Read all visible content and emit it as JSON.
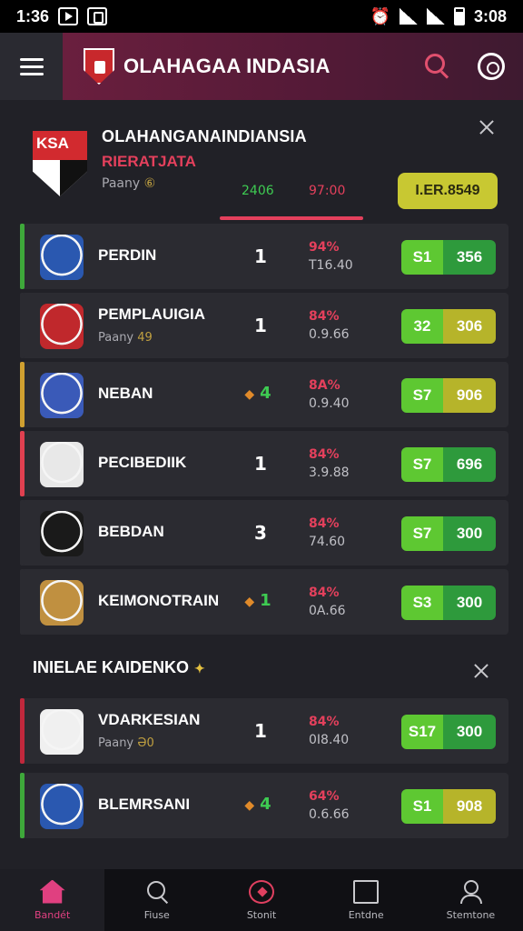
{
  "status_bar": {
    "time": "1:36",
    "clock_right": "3:08"
  },
  "app_bar": {
    "title": "OLAHAGAA INDASIA"
  },
  "league": {
    "logo_text": "KSA",
    "title": "OLAHANGANAINDIANSIA",
    "subtitle": "RIERATJATA",
    "meta_label": "Paany",
    "meta_value": "⑥",
    "score_a": "2406",
    "score_b": "97:00",
    "odds": "I.ER.8549"
  },
  "matches": [
    {
      "name": "PERDIN",
      "meta_label": "",
      "meta_value": "",
      "score": "1",
      "pct": "94%",
      "line": "T16.40",
      "odd_a": "S1",
      "odd_b": "356",
      "accent": "#3ea83a",
      "crest": "#2a58b0",
      "pill": "green"
    },
    {
      "name": "PEMPLAUIGIA",
      "meta_label": "Paany",
      "meta_value": "49",
      "score": "1",
      "pct": "84%",
      "line": "0.9.66",
      "odd_a": "32",
      "odd_b": "306",
      "accent": "#2b2b31",
      "crest": "#c0282c",
      "pill": "yellow"
    },
    {
      "name": "NEBAN",
      "meta_label": "",
      "meta_value": "",
      "score": "4",
      "pct": "8A%",
      "line": "0.9.40",
      "odd_a": "S7",
      "odd_b": "906",
      "accent": "#d0a030",
      "crest": "#3a5ab8",
      "pill": "yellow",
      "score_style": "green"
    },
    {
      "name": "PECIBEDIIK",
      "meta_label": "",
      "meta_value": "",
      "score": "1",
      "pct": "84%",
      "line": "3.9.88",
      "odd_a": "S7",
      "odd_b": "696",
      "accent": "#e04050",
      "crest": "#e8e8e8",
      "pill": "green"
    },
    {
      "name": "BEBDAN",
      "meta_label": "",
      "meta_value": "",
      "score": "3",
      "pct": "84%",
      "line": "74.60",
      "odd_a": "S7",
      "odd_b": "300",
      "accent": "#2b2b31",
      "crest": "#1a1a1a",
      "pill": "green"
    },
    {
      "name": "KEIMONOTRAIN",
      "meta_label": "",
      "meta_value": "",
      "score": "1",
      "pct": "84%",
      "line": "0A.66",
      "odd_a": "S3",
      "odd_b": "300",
      "accent": "#2b2b31",
      "crest": "#c09040",
      "pill": "green",
      "score_style": "green"
    }
  ],
  "section2": {
    "title": "INIELAE KAIDENKO",
    "flag": "✦"
  },
  "matches2": [
    {
      "name": "VDARKESIAN",
      "meta_label": "Paany",
      "meta_value": "Ə0",
      "score": "1",
      "pct": "84%",
      "line": "0I8.40",
      "odd_a": "S17",
      "odd_b": "300",
      "accent": "#c0283c",
      "crest": "#f0f0f0",
      "pill": "green"
    },
    {
      "name": "BLEMRSANI",
      "meta_label": "",
      "meta_value": "",
      "score": "4",
      "pct": "64%",
      "line": "0.6.66",
      "odd_a": "S1",
      "odd_b": "908",
      "accent": "#3ea83a",
      "crest": "#2a58b0",
      "pill": "yellow",
      "score_style": "green"
    }
  ],
  "bottom_nav": [
    {
      "label": "Bandét",
      "icon": "home-icon",
      "active": true
    },
    {
      "label": "Fiuse",
      "icon": "search-icon",
      "active": false
    },
    {
      "label": "Stonit",
      "icon": "compass-icon",
      "active": false
    },
    {
      "label": "Entdne",
      "icon": "box-icon",
      "active": false
    },
    {
      "label": "Stemtone",
      "icon": "user-icon",
      "active": false
    }
  ]
}
